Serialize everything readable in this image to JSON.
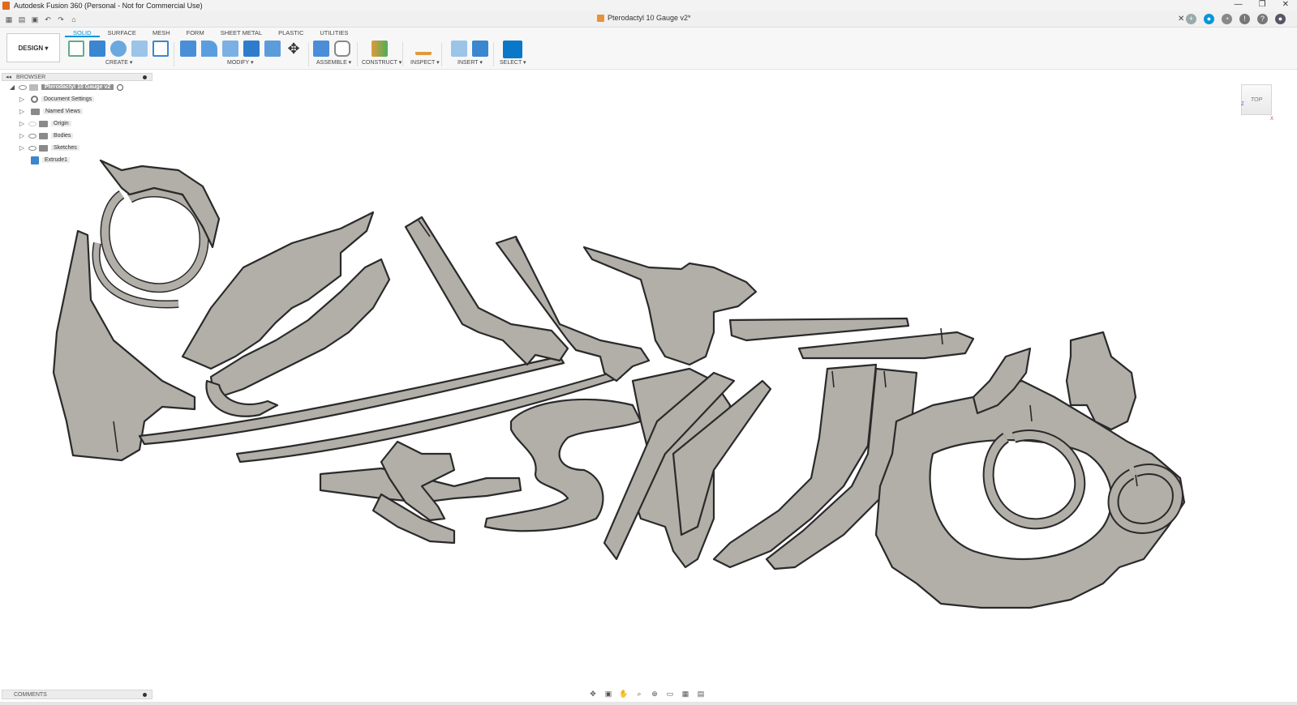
{
  "window": {
    "title": "Autodesk Fusion 360 (Personal - Not for Commercial Use)",
    "controls": [
      "—",
      "❐",
      "✕"
    ]
  },
  "document": {
    "tab_title": "Pterodactyl 10 Gauge v2*"
  },
  "toolbar": {
    "workspace_label": "DESIGN ▾",
    "tabs": [
      "SOLID",
      "SURFACE",
      "MESH",
      "FORM",
      "SHEET METAL",
      "PLASTIC",
      "UTILITIES"
    ],
    "active_tab": "SOLID",
    "groups": {
      "create": "CREATE ▾",
      "modify": "MODIFY ▾",
      "assemble": "ASSEMBLE ▾",
      "construct": "CONSTRUCT ▾",
      "inspect": "INSPECT ▾",
      "insert": "INSERT ▾",
      "select": "SELECT ▾"
    }
  },
  "browser": {
    "header": "BROWSER",
    "root": "Pterodactyl 10 Gauge v2",
    "items": [
      {
        "label": "Document Settings",
        "icon": "gear-icon"
      },
      {
        "label": "Named Views",
        "icon": "folder-icon"
      },
      {
        "label": "Origin",
        "icon": "folder-icon"
      },
      {
        "label": "Bodies",
        "icon": "folder-icon"
      },
      {
        "label": "Sketches",
        "icon": "folder-icon"
      },
      {
        "label": "Extrude1",
        "icon": "extrude-icon"
      }
    ]
  },
  "viewcube": {
    "face": "TOP",
    "x": "X",
    "z": "Z"
  },
  "comments": {
    "label": "COMMENTS"
  },
  "colors": {
    "accent": "#0696d7",
    "part_fill": "#b2aea8",
    "part_edge": "#2a2a2a"
  }
}
